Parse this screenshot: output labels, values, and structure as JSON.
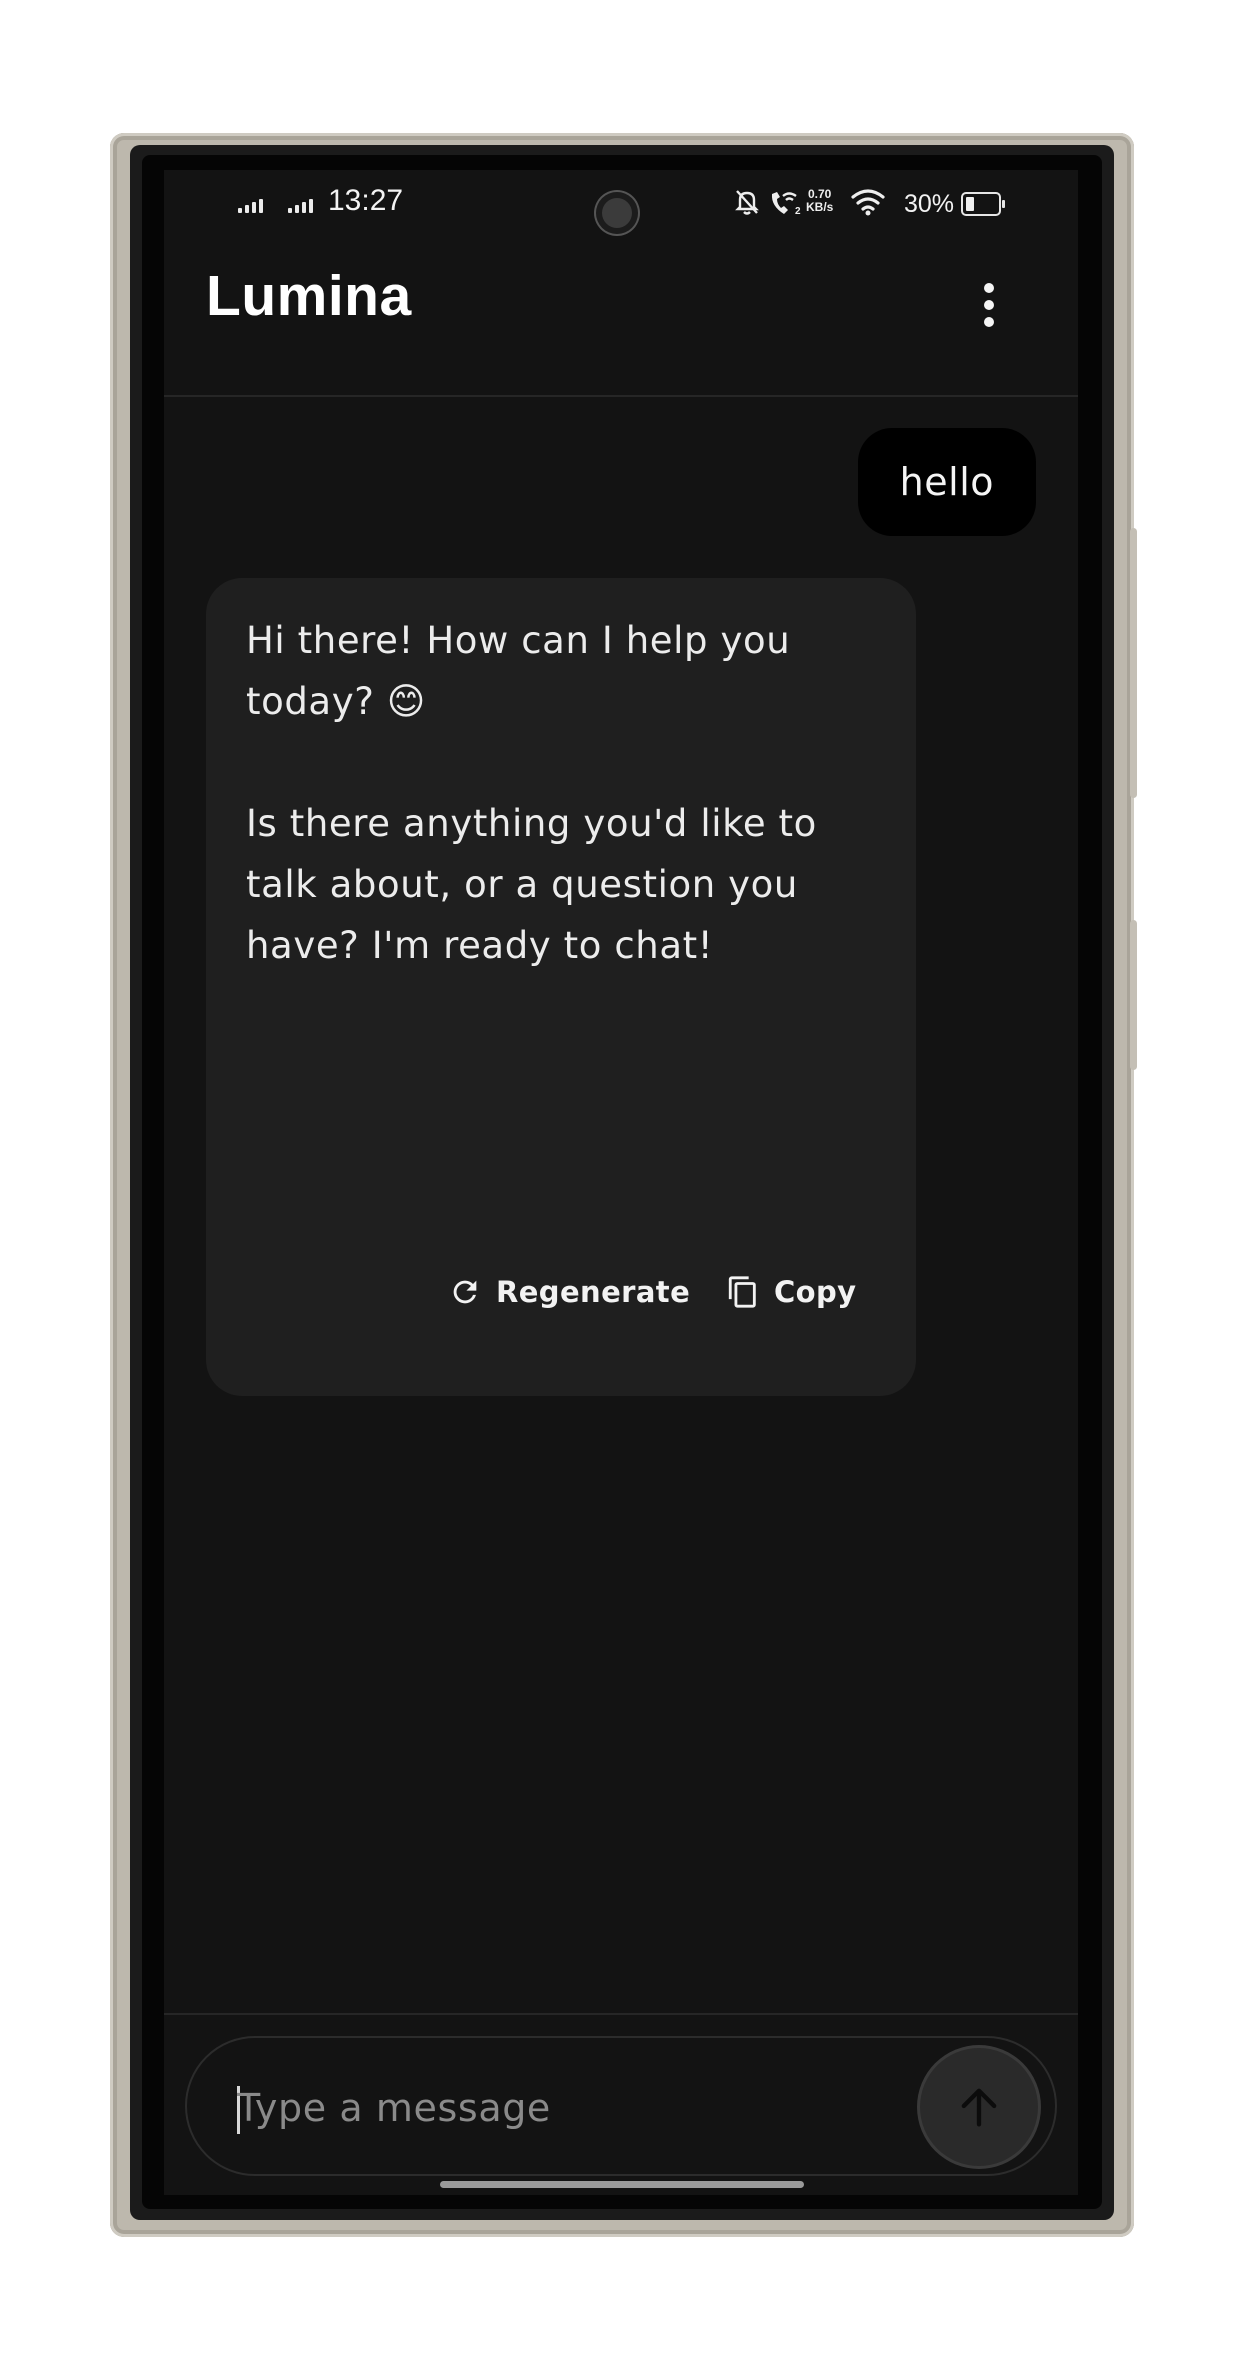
{
  "status_bar": {
    "time": "13:27",
    "network_speed_value": "0.70",
    "network_speed_unit": "KB/s",
    "battery_percent": "30%",
    "battery_level": 0.3,
    "icons": [
      "signal-icon",
      "signal-icon",
      "camera-cutout",
      "mute-notifications-icon",
      "wifi-calling-icon",
      "wifi-icon",
      "battery-icon"
    ]
  },
  "app_bar": {
    "title": "Lumina",
    "menu_icon": "more-vertical-icon"
  },
  "conversation": {
    "messages": [
      {
        "role": "user",
        "text": "hello"
      },
      {
        "role": "assistant",
        "text": "Hi there! How can I help you\ntoday? 😊\n\nIs there anything you'd like to\ntalk about, or a question you\nhave? I'm ready to chat!"
      }
    ],
    "actions": {
      "regenerate_label": "Regenerate",
      "regenerate_icon": "refresh-icon",
      "copy_label": "Copy",
      "copy_icon": "copy-icon"
    }
  },
  "composer": {
    "placeholder": "Type a message",
    "value": "",
    "send_icon": "arrow-up-icon"
  }
}
